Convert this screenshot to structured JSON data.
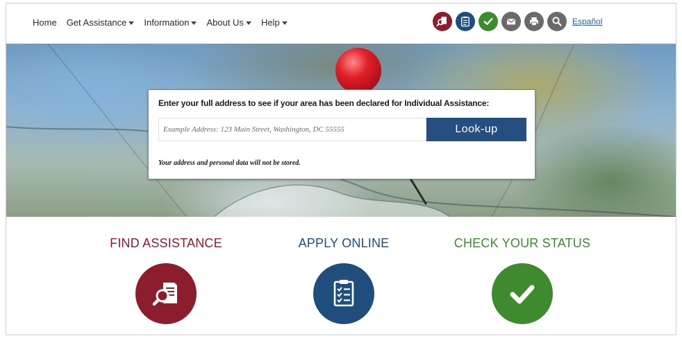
{
  "nav": {
    "items": [
      {
        "label": "Home",
        "dropdown": false
      },
      {
        "label": "Get Assistance",
        "dropdown": true
      },
      {
        "label": "Information",
        "dropdown": true
      },
      {
        "label": "About Us",
        "dropdown": true
      },
      {
        "label": "Help",
        "dropdown": true
      }
    ],
    "tools": [
      {
        "icon": "find-assistance-icon",
        "color": "#8b1d2c"
      },
      {
        "icon": "apply-online-icon",
        "color": "#1f4e7d"
      },
      {
        "icon": "check-status-icon",
        "color": "#3e8a2f"
      },
      {
        "icon": "email-icon",
        "color": "#6a6a6a"
      },
      {
        "icon": "print-icon",
        "color": "#6a6a6a"
      },
      {
        "icon": "search-icon",
        "color": "#6a6a6a"
      }
    ],
    "language_link": "Español"
  },
  "hero": {
    "lookup": {
      "title": "Enter your full address to see if your area has been declared for Individual Assistance:",
      "placeholder": "Example Address: 123 Main Street, Washington, DC 55555",
      "value": "",
      "button_label": "Look-up",
      "note": "Your address and personal data will not be stored."
    }
  },
  "actions": [
    {
      "label": "FIND ASSISTANCE",
      "color": "#8b1d2c",
      "icon": "find-assistance-icon"
    },
    {
      "label": "APPLY ONLINE",
      "color": "#1f4e7d",
      "icon": "clipboard-checklist-icon"
    },
    {
      "label": "CHECK YOUR STATUS",
      "color": "#3e8a2f",
      "icon": "checkmark-icon"
    }
  ],
  "colors": {
    "button_blue": "#254f80",
    "find_red": "#8b1d2c",
    "apply_blue": "#1f4e7d",
    "status_green": "#3e8a2f"
  }
}
